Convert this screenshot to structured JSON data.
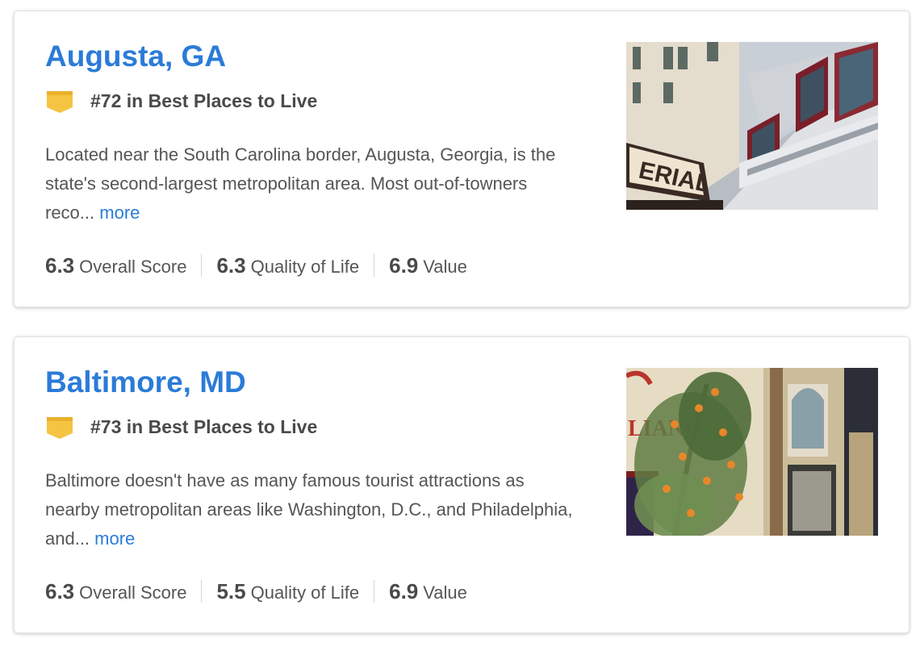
{
  "cards": [
    {
      "title": "Augusta, GA",
      "rank_icon": "rank-badge-icon",
      "rank": "#72 in Best Places to Live",
      "description": "Located near the South Carolina border, Augusta, Georgia, is the state's second-largest metropolitan area. Most out-of-towners reco...",
      "more_label": "more",
      "scores": [
        {
          "value": "6.3",
          "label": "Overall Score"
        },
        {
          "value": "6.3",
          "label": "Quality of Life"
        },
        {
          "value": "6.9",
          "label": "Value"
        }
      ],
      "image": "augusta-building-photo",
      "image_sign_text": "ERIAL"
    },
    {
      "title": "Baltimore, MD",
      "rank_icon": "rank-badge-icon",
      "rank": "#73 in Best Places to Live",
      "description": "Baltimore doesn't have as many famous tourist attractions as nearby metropolitan areas like Washington, D.C., and Philadelphia, and...",
      "more_label": "more",
      "scores": [
        {
          "value": "6.3",
          "label": "Overall Score"
        },
        {
          "value": "5.5",
          "label": "Quality of Life"
        },
        {
          "value": "6.9",
          "label": "Value"
        }
      ],
      "image": "baltimore-mural-photo",
      "image_sign_text": "LIANO"
    }
  ],
  "colors": {
    "link": "#2b7bd8",
    "badge": "#f5c442",
    "text": "#555555",
    "heading_text": "#4a4a4a"
  }
}
